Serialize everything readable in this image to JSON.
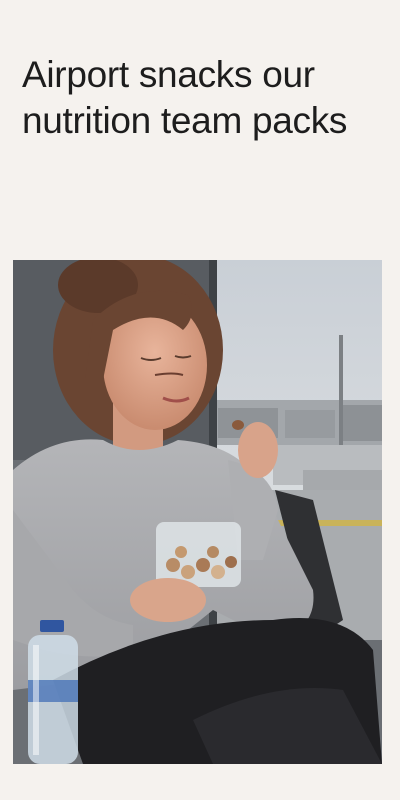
{
  "article": {
    "headline": "Airport snacks our nutrition team packs"
  },
  "photo": {
    "subject": "woman-eating-nuts-at-airport-gate-photo"
  },
  "colors": {
    "background": "#f5f2ee",
    "headline_text": "#1d1d1d"
  }
}
